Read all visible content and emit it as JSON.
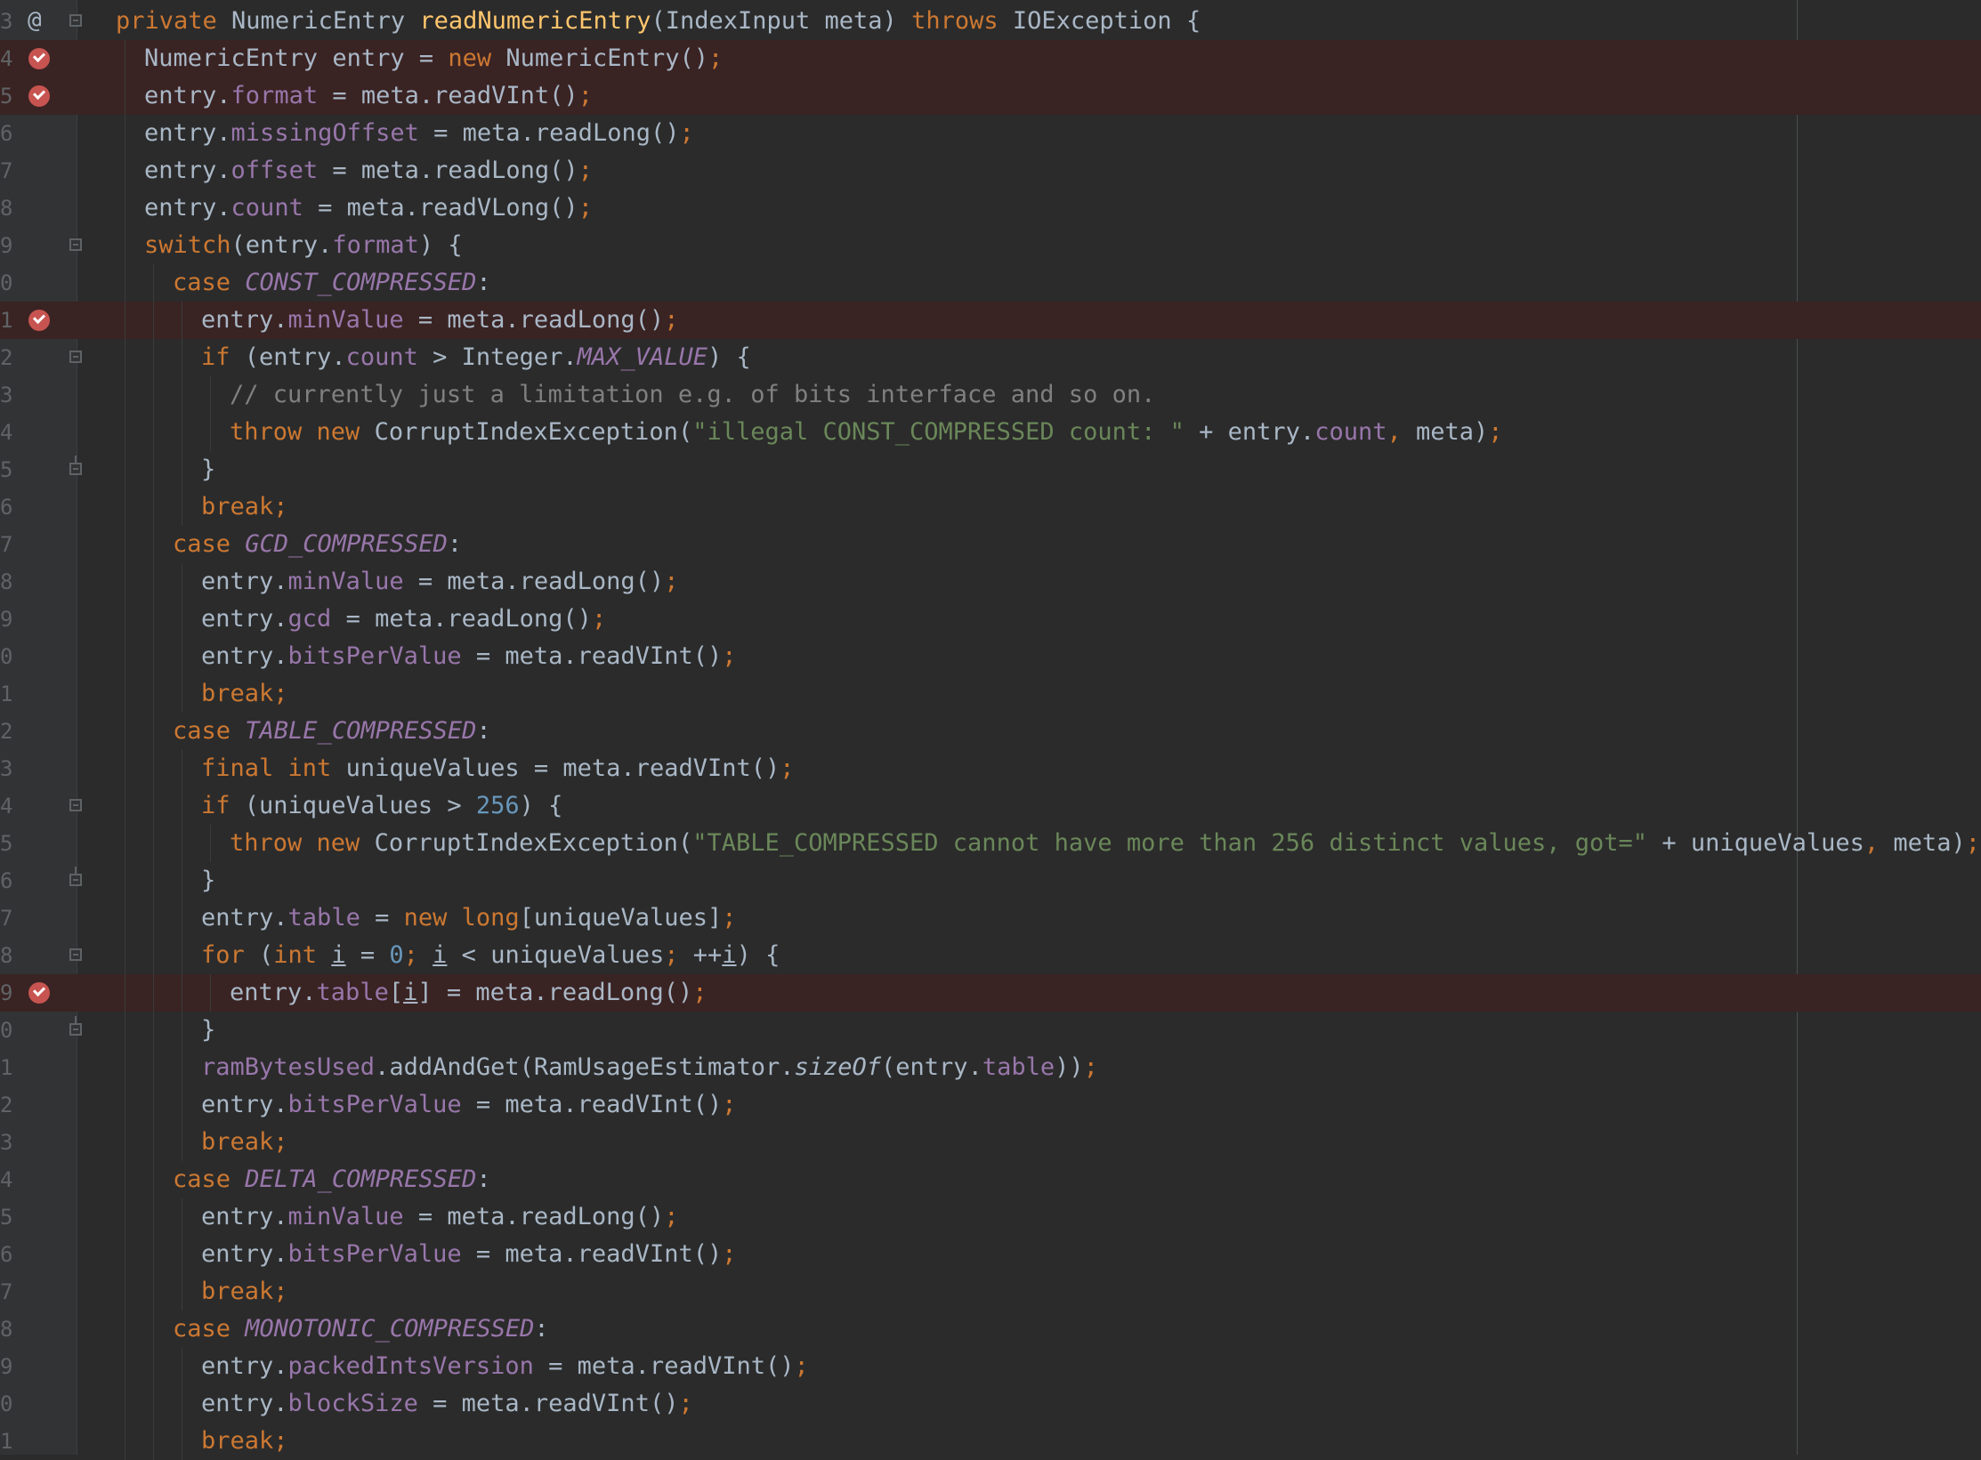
{
  "editor": {
    "colors": {
      "background": "#2b2b2b",
      "gutter": "#313335",
      "breakpoint_line": "#3a2323",
      "breakpoint": "#c75450",
      "keyword": "#cc7832",
      "field": "#9876aa",
      "method": "#ffc66d",
      "string": "#6a8759",
      "number": "#6897bb",
      "comment": "#808080",
      "text": "#a9b7c6"
    },
    "lines": [
      {
        "num": "3",
        "marker": "at",
        "fold": "start",
        "indent": 0,
        "tokens": [
          {
            "t": "private ",
            "c": "k"
          },
          {
            "t": "NumericEntry "
          },
          {
            "t": "readNumericEntry",
            "c": "m"
          },
          {
            "t": "(IndexInput meta) "
          },
          {
            "t": "throws ",
            "c": "k"
          },
          {
            "t": "IOException {"
          }
        ]
      },
      {
        "num": "4",
        "marker": "bp",
        "indent": 1,
        "tokens": [
          {
            "t": "NumericEntry entry = "
          },
          {
            "t": "new ",
            "c": "k"
          },
          {
            "t": "NumericEntry()"
          },
          {
            "t": ";",
            "c": "k"
          }
        ]
      },
      {
        "num": "5",
        "marker": "bp",
        "indent": 1,
        "tokens": [
          {
            "t": "entry."
          },
          {
            "t": "format",
            "c": "f"
          },
          {
            "t": " = meta.readVInt()"
          },
          {
            "t": ";",
            "c": "k"
          }
        ]
      },
      {
        "num": "6",
        "indent": 1,
        "tokens": [
          {
            "t": "entry."
          },
          {
            "t": "missingOffset",
            "c": "f"
          },
          {
            "t": " = meta.readLong()"
          },
          {
            "t": ";",
            "c": "k"
          }
        ]
      },
      {
        "num": "7",
        "indent": 1,
        "tokens": [
          {
            "t": "entry."
          },
          {
            "t": "offset",
            "c": "f"
          },
          {
            "t": " = meta.readLong()"
          },
          {
            "t": ";",
            "c": "k"
          }
        ]
      },
      {
        "num": "8",
        "indent": 1,
        "tokens": [
          {
            "t": "entry."
          },
          {
            "t": "count",
            "c": "f"
          },
          {
            "t": " = meta.readVLong()"
          },
          {
            "t": ";",
            "c": "k"
          }
        ]
      },
      {
        "num": "9",
        "fold": "start",
        "indent": 1,
        "tokens": [
          {
            "t": "switch",
            "c": "k"
          },
          {
            "t": "(entry."
          },
          {
            "t": "format",
            "c": "f"
          },
          {
            "t": ") {"
          }
        ]
      },
      {
        "num": "0",
        "indent": 2,
        "tokens": [
          {
            "t": "case ",
            "c": "k"
          },
          {
            "t": "CONST_COMPRESSED",
            "c": "c"
          },
          {
            "t": ":"
          }
        ]
      },
      {
        "num": "1",
        "marker": "bp",
        "indent": 3,
        "tokens": [
          {
            "t": "entry."
          },
          {
            "t": "minValue",
            "c": "f"
          },
          {
            "t": " = meta.readLong()"
          },
          {
            "t": ";",
            "c": "k"
          }
        ]
      },
      {
        "num": "2",
        "fold": "start",
        "indent": 3,
        "tokens": [
          {
            "t": "if ",
            "c": "k"
          },
          {
            "t": "(entry."
          },
          {
            "t": "count",
            "c": "f"
          },
          {
            "t": " > Integer."
          },
          {
            "t": "MAX_VALUE",
            "c": "c"
          },
          {
            "t": ") {"
          }
        ]
      },
      {
        "num": "3",
        "indent": 4,
        "tokens": [
          {
            "t": "// currently just a limitation e.g. of bits interface and so on.",
            "c": "cm"
          }
        ]
      },
      {
        "num": "4",
        "indent": 4,
        "tokens": [
          {
            "t": "throw ",
            "c": "k"
          },
          {
            "t": "new ",
            "c": "k"
          },
          {
            "t": "CorruptIndexException("
          },
          {
            "t": "\"illegal CONST_COMPRESSED count: \"",
            "c": "s"
          },
          {
            "t": " + entry."
          },
          {
            "t": "count",
            "c": "f"
          },
          {
            "t": ", ",
            "c": "k"
          },
          {
            "t": "meta)"
          },
          {
            "t": ";",
            "c": "k"
          }
        ]
      },
      {
        "num": "5",
        "fold": "end",
        "indent": 3,
        "tokens": [
          {
            "t": "}"
          }
        ]
      },
      {
        "num": "6",
        "indent": 3,
        "tokens": [
          {
            "t": "break;",
            "c": "k"
          }
        ]
      },
      {
        "num": "7",
        "indent": 2,
        "tokens": [
          {
            "t": "case ",
            "c": "k"
          },
          {
            "t": "GCD_COMPRESSED",
            "c": "c"
          },
          {
            "t": ":"
          }
        ]
      },
      {
        "num": "8",
        "indent": 3,
        "tokens": [
          {
            "t": "entry."
          },
          {
            "t": "minValue",
            "c": "f"
          },
          {
            "t": " = meta.readLong()"
          },
          {
            "t": ";",
            "c": "k"
          }
        ]
      },
      {
        "num": "9",
        "indent": 3,
        "tokens": [
          {
            "t": "entry."
          },
          {
            "t": "gcd",
            "c": "f"
          },
          {
            "t": " = meta.readLong()"
          },
          {
            "t": ";",
            "c": "k"
          }
        ]
      },
      {
        "num": "0",
        "indent": 3,
        "tokens": [
          {
            "t": "entry."
          },
          {
            "t": "bitsPerValue",
            "c": "f"
          },
          {
            "t": " = meta.readVInt()"
          },
          {
            "t": ";",
            "c": "k"
          }
        ]
      },
      {
        "num": "1",
        "indent": 3,
        "tokens": [
          {
            "t": "break;",
            "c": "k"
          }
        ]
      },
      {
        "num": "2",
        "indent": 2,
        "tokens": [
          {
            "t": "case ",
            "c": "k"
          },
          {
            "t": "TABLE_COMPRESSED",
            "c": "c"
          },
          {
            "t": ":"
          }
        ]
      },
      {
        "num": "3",
        "indent": 3,
        "tokens": [
          {
            "t": "final ",
            "c": "k"
          },
          {
            "t": "int ",
            "c": "k"
          },
          {
            "t": "uniqueValues = meta.readVInt()"
          },
          {
            "t": ";",
            "c": "k"
          }
        ]
      },
      {
        "num": "4",
        "fold": "start",
        "indent": 3,
        "tokens": [
          {
            "t": "if ",
            "c": "k"
          },
          {
            "t": "(uniqueValues > "
          },
          {
            "t": "256",
            "c": "n"
          },
          {
            "t": ") {"
          }
        ]
      },
      {
        "num": "5",
        "indent": 4,
        "tokens": [
          {
            "t": "throw ",
            "c": "k"
          },
          {
            "t": "new ",
            "c": "k"
          },
          {
            "t": "CorruptIndexException("
          },
          {
            "t": "\"TABLE_COMPRESSED cannot have more than 256 distinct values, got=\"",
            "c": "s"
          },
          {
            "t": " + uniqueValues"
          },
          {
            "t": ", ",
            "c": "k"
          },
          {
            "t": "meta)"
          },
          {
            "t": ";",
            "c": "k"
          }
        ]
      },
      {
        "num": "6",
        "fold": "end",
        "indent": 3,
        "tokens": [
          {
            "t": "}"
          }
        ]
      },
      {
        "num": "7",
        "indent": 3,
        "tokens": [
          {
            "t": "entry."
          },
          {
            "t": "table",
            "c": "f"
          },
          {
            "t": " = "
          },
          {
            "t": "new ",
            "c": "k"
          },
          {
            "t": "long",
            "c": "k"
          },
          {
            "t": "[uniqueValues]"
          },
          {
            "t": ";",
            "c": "k"
          }
        ]
      },
      {
        "num": "8",
        "fold": "start",
        "indent": 3,
        "tokens": [
          {
            "t": "for ",
            "c": "k"
          },
          {
            "t": "("
          },
          {
            "t": "int ",
            "c": "k"
          },
          {
            "t": "i",
            "c": "u"
          },
          {
            "t": " = "
          },
          {
            "t": "0",
            "c": "n"
          },
          {
            "t": "; ",
            "c": "k"
          },
          {
            "t": "i",
            "c": "u"
          },
          {
            "t": " < uniqueValues"
          },
          {
            "t": "; ",
            "c": "k"
          },
          {
            "t": "++"
          },
          {
            "t": "i",
            "c": "u"
          },
          {
            "t": ") {"
          }
        ]
      },
      {
        "num": "9",
        "marker": "bp",
        "indent": 4,
        "tokens": [
          {
            "t": "entry."
          },
          {
            "t": "table",
            "c": "f"
          },
          {
            "t": "["
          },
          {
            "t": "i",
            "c": "u"
          },
          {
            "t": "] = meta.readLong()"
          },
          {
            "t": ";",
            "c": "k"
          }
        ]
      },
      {
        "num": "0",
        "fold": "end",
        "indent": 3,
        "tokens": [
          {
            "t": "}"
          }
        ]
      },
      {
        "num": "1",
        "indent": 3,
        "tokens": [
          {
            "t": "ramBytesUsed",
            "c": "f"
          },
          {
            "t": ".addAndGet(RamUsageEstimator."
          },
          {
            "t": "sizeOf",
            "c": "it"
          },
          {
            "t": "(entry."
          },
          {
            "t": "table",
            "c": "f"
          },
          {
            "t": "))"
          },
          {
            "t": ";",
            "c": "k"
          }
        ]
      },
      {
        "num": "2",
        "indent": 3,
        "tokens": [
          {
            "t": "entry."
          },
          {
            "t": "bitsPerValue",
            "c": "f"
          },
          {
            "t": " = meta.readVInt()"
          },
          {
            "t": ";",
            "c": "k"
          }
        ]
      },
      {
        "num": "3",
        "indent": 3,
        "tokens": [
          {
            "t": "break;",
            "c": "k"
          }
        ]
      },
      {
        "num": "4",
        "indent": 2,
        "tokens": [
          {
            "t": "case ",
            "c": "k"
          },
          {
            "t": "DELTA_COMPRESSED",
            "c": "c"
          },
          {
            "t": ":"
          }
        ]
      },
      {
        "num": "5",
        "indent": 3,
        "tokens": [
          {
            "t": "entry."
          },
          {
            "t": "minValue",
            "c": "f"
          },
          {
            "t": " = meta.readLong()"
          },
          {
            "t": ";",
            "c": "k"
          }
        ]
      },
      {
        "num": "6",
        "indent": 3,
        "tokens": [
          {
            "t": "entry."
          },
          {
            "t": "bitsPerValue",
            "c": "f"
          },
          {
            "t": " = meta.readVInt()"
          },
          {
            "t": ";",
            "c": "k"
          }
        ]
      },
      {
        "num": "7",
        "indent": 3,
        "tokens": [
          {
            "t": "break;",
            "c": "k"
          }
        ]
      },
      {
        "num": "8",
        "indent": 2,
        "tokens": [
          {
            "t": "case ",
            "c": "k"
          },
          {
            "t": "MONOTONIC_COMPRESSED",
            "c": "c"
          },
          {
            "t": ":"
          }
        ]
      },
      {
        "num": "9",
        "indent": 3,
        "tokens": [
          {
            "t": "entry."
          },
          {
            "t": "packedIntsVersion",
            "c": "f"
          },
          {
            "t": " = meta.readVInt()"
          },
          {
            "t": ";",
            "c": "k"
          }
        ]
      },
      {
        "num": "0",
        "indent": 3,
        "tokens": [
          {
            "t": "entry."
          },
          {
            "t": "blockSize",
            "c": "f"
          },
          {
            "t": " = meta.readVInt()"
          },
          {
            "t": ";",
            "c": "k"
          }
        ]
      },
      {
        "num": "1",
        "indent": 3,
        "tokens": [
          {
            "t": "break;",
            "c": "k"
          }
        ]
      }
    ]
  }
}
